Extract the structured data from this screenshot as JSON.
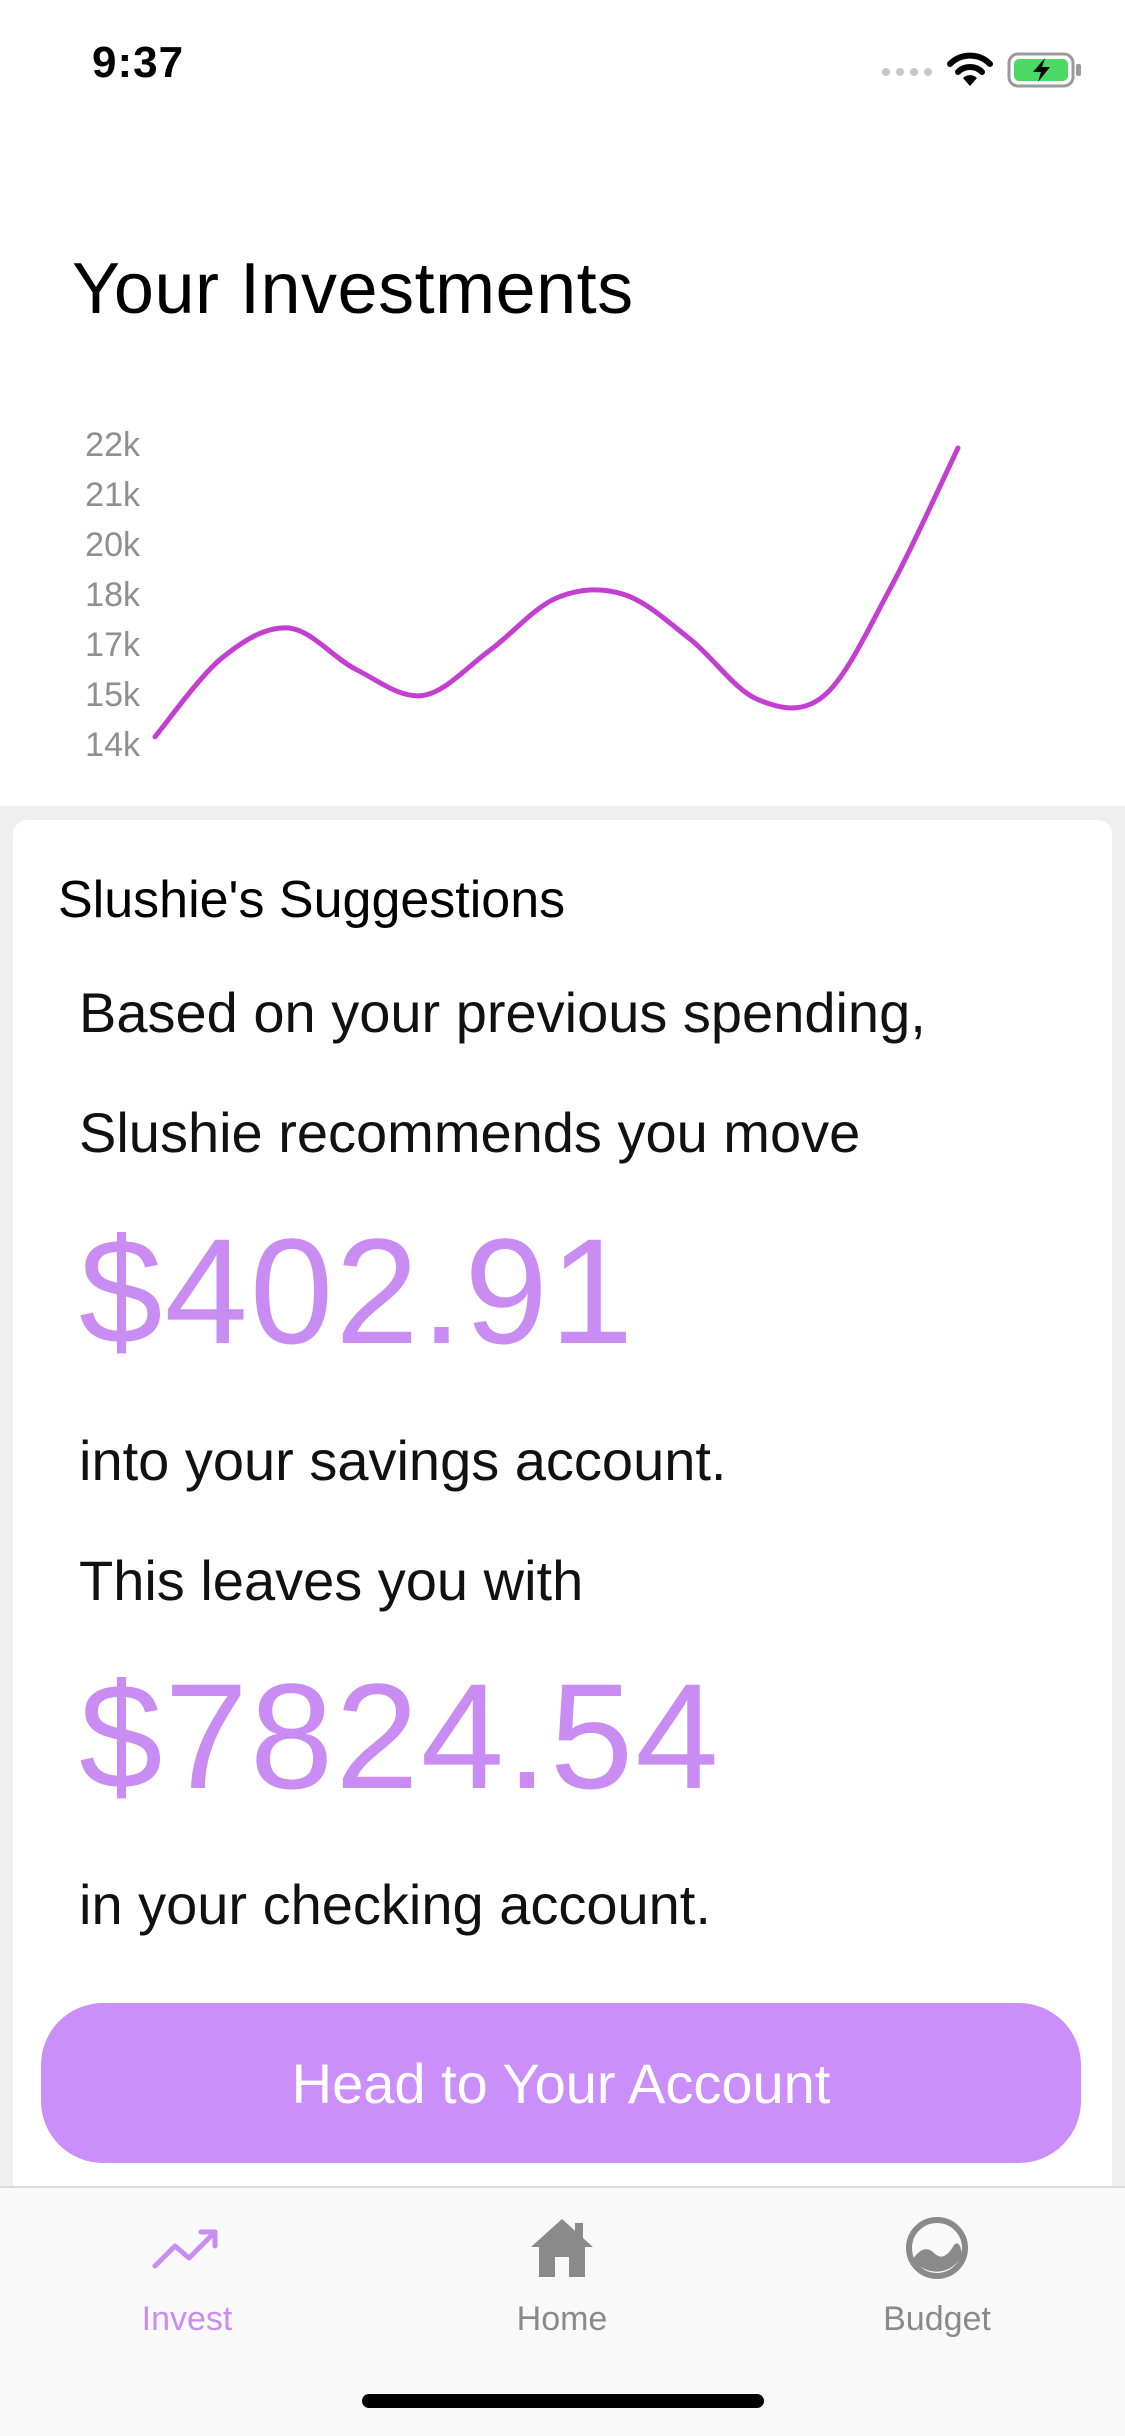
{
  "status_bar": {
    "time": "9:37"
  },
  "page": {
    "title": "Your Investments"
  },
  "chart_data": {
    "type": "line",
    "title": "",
    "xlabel": "",
    "ylabel": "",
    "y_tick_labels": [
      "22k",
      "21k",
      "20k",
      "18k",
      "17k",
      "15k",
      "14k"
    ],
    "ylim": [
      14000,
      22000
    ],
    "grid": false,
    "legend": "none",
    "series": [
      {
        "color": "#c23fd1",
        "x": [
          0,
          1,
          2,
          3,
          4,
          5,
          6,
          7,
          8,
          9,
          10,
          11,
          12
        ],
        "y": [
          14300,
          16400,
          17200,
          16100,
          15400,
          16600,
          18000,
          18100,
          16900,
          15300,
          15400,
          18300,
          22000
        ]
      }
    ]
  },
  "suggestions": {
    "heading": "Slushie's Suggestions",
    "line1": "Based on your previous spending,",
    "line2": "Slushie recommends you move",
    "move_amount": "$402.91",
    "line3": "into your savings account.",
    "line4": "This leaves you with",
    "remaining_amount": "$7824.54",
    "line5": "in your checking account.",
    "button_label": "Head to Your Account"
  },
  "tab_bar": {
    "tabs": [
      {
        "label": "Invest",
        "icon": "trending-up-icon",
        "active": true
      },
      {
        "label": "Home",
        "icon": "house-icon",
        "active": false
      },
      {
        "label": "Budget",
        "icon": "gauge-icon",
        "active": false
      }
    ]
  },
  "colors": {
    "accent": "#c98cf3",
    "chart_line": "#c23fd1",
    "tab_inactive": "#8a8a8a"
  }
}
